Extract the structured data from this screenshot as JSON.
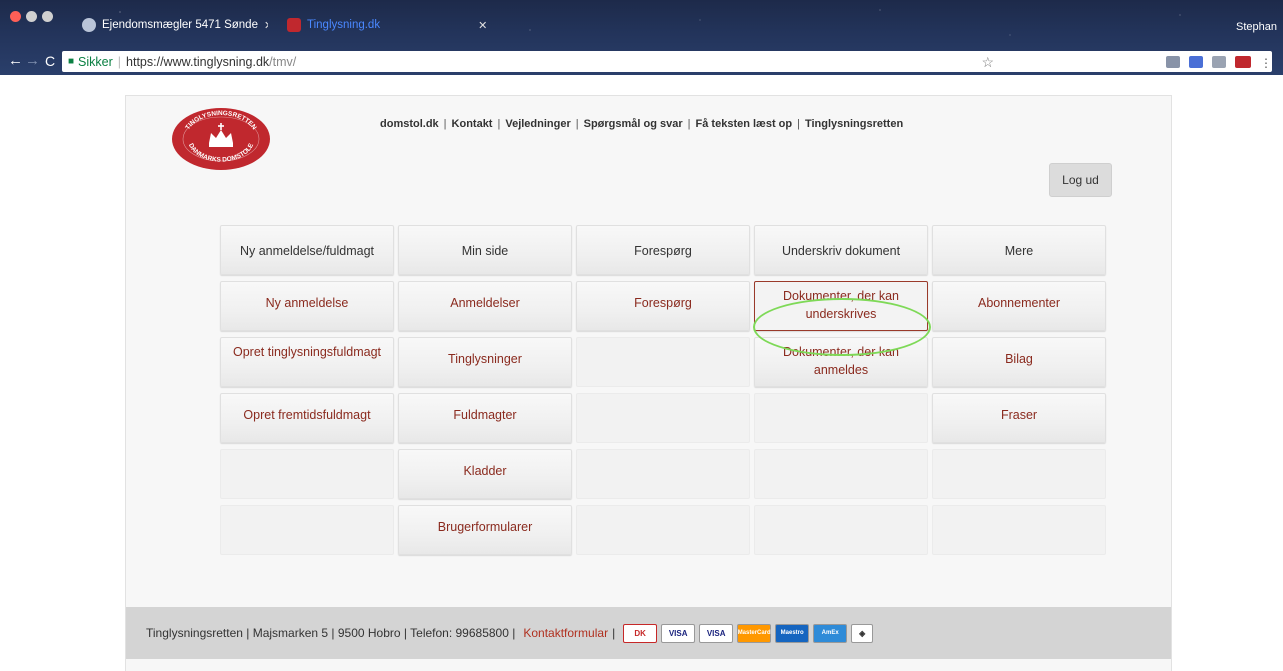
{
  "browser": {
    "tabs": [
      {
        "label": "Ejendomsmægler 5471 Sønde",
        "active": false
      },
      {
        "label": "Tinglysning.dk",
        "active": true
      }
    ],
    "profile_name": "Stephan",
    "address": {
      "secure_label": "Sikker",
      "url_host": "https://www.tinglysning.dk",
      "url_path": "/tmv/"
    }
  },
  "logo": {
    "top_text": "TINGLYSNINGSRETTEN",
    "bottom_text": "DANMARKS DOMSTOLE"
  },
  "topnav": {
    "items": [
      "domstol.dk",
      "Kontakt",
      "Vejledninger",
      "Spørgsmål og svar",
      "Få teksten læst op",
      "Tinglysningsretten"
    ]
  },
  "logout_label": "Log ud",
  "menu": {
    "columns": [
      {
        "header": "Ny anmeldelse/fuldmagt",
        "items": [
          "Ny anmeldelse",
          "Opret tinglysningsfuldmagt",
          "Opret fremtidsfuldmagt",
          "",
          ""
        ]
      },
      {
        "header": "Min side",
        "items": [
          "Anmeldelser",
          "Tinglysninger",
          "Fuldmagter",
          "Kladder",
          "Brugerformularer"
        ]
      },
      {
        "header": "Forespørg",
        "items": [
          "Forespørg",
          "",
          "",
          "",
          ""
        ]
      },
      {
        "header": "Underskriv dokument",
        "items": [
          "Dokumenter, der kan underskrives",
          "Dokumenter, der kan anmeldes",
          "",
          "",
          ""
        ]
      },
      {
        "header": "Mere",
        "items": [
          "Abonnementer",
          "Bilag",
          "Fraser",
          "",
          ""
        ]
      }
    ]
  },
  "footer": {
    "address": "Tinglysningsretten | Majsmarken 5 | 9500 Hobro | Telefon: 99685800 |",
    "contact_link": "Kontaktformular",
    "cards": [
      "DK",
      "VISA",
      "VISA",
      "MasterCard",
      "Maestro",
      "AmEx",
      "Secure"
    ]
  },
  "colors": {
    "link_red": "#8a2a1e",
    "logo_red": "#c0282e",
    "highlight_green": "#7ed957"
  }
}
